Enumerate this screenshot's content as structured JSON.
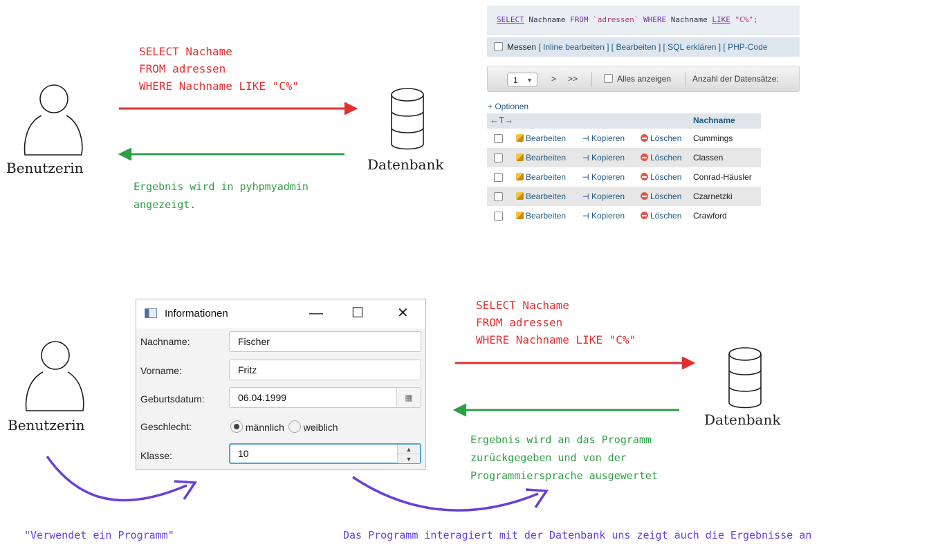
{
  "top": {
    "query_lines": [
      "SELECT Nachame",
      "FROM adressen",
      "WHERE Nachname LIKE \"C%\""
    ],
    "user_label": "Benutzerin",
    "db_label": "Datenbank",
    "result_lines": [
      "Ergebnis wird in pyhpmyadmin",
      "angezeigt."
    ]
  },
  "phpmyadmin": {
    "sql": {
      "kw_select": "SELECT",
      "col": " Nachname ",
      "kw_from": "FROM",
      "table": " `adressen` ",
      "kw_where": "WHERE",
      "col2": " Nachname ",
      "kw_like": "LIKE",
      "str": " \"C%\";"
    },
    "link_bar": {
      "messen": "Messen",
      "links": "[ Inline bearbeiten ] [ Bearbeiten ] [ SQL erklären ] [ PHP-Code"
    },
    "nav": {
      "page": "1",
      "next": ">",
      "last": ">>",
      "show_all": "Alles anzeigen",
      "count_label": "Anzahl der Datensätze:"
    },
    "options_link": "+ Optionen",
    "header": {
      "arrows": "←T→",
      "column": "Nachname"
    },
    "actions": {
      "edit": "Bearbeiten",
      "copy": "Kopieren",
      "delete": "Löschen"
    },
    "rows": [
      "Cummings",
      "Classen",
      "Conrad-Häusler",
      "Czarnetzki",
      "Crawford"
    ]
  },
  "dialog": {
    "title": "Informationen",
    "controls": {
      "minimize": "—",
      "maximize": "☐",
      "close": "✕"
    },
    "fields": {
      "nachname_label": "Nachname:",
      "nachname_value": "Fischer",
      "vorname_label": "Vorname:",
      "vorname_value": "Fritz",
      "geburtsdatum_label": "Geburtsdatum:",
      "geburtsdatum_value": "06.04.1999",
      "geschlecht_label": "Geschlecht:",
      "option_m": "männlich",
      "option_w": "weiblich",
      "klasse_label": "Klasse:",
      "klasse_value": "10"
    }
  },
  "bottom": {
    "query_lines": [
      "SELECT Nachame",
      "FROM adressen",
      "WHERE Nachname LIKE \"C%\""
    ],
    "user_label": "Benutzerin",
    "db_label": "Datenbank",
    "result_lines": [
      "Ergebnis wird an das Programm",
      "zurückgegeben und von der",
      "Programmiersprache ausgewertet"
    ],
    "uses_program": "\"Verwendet ein Programm\"",
    "caption": "Das Programm interagiert mit der Datenbank uns zeigt auch die Ergebnisse an"
  },
  "colors": {
    "red": "#e03131",
    "green": "#2f9e44",
    "purple": "#6741d9"
  }
}
